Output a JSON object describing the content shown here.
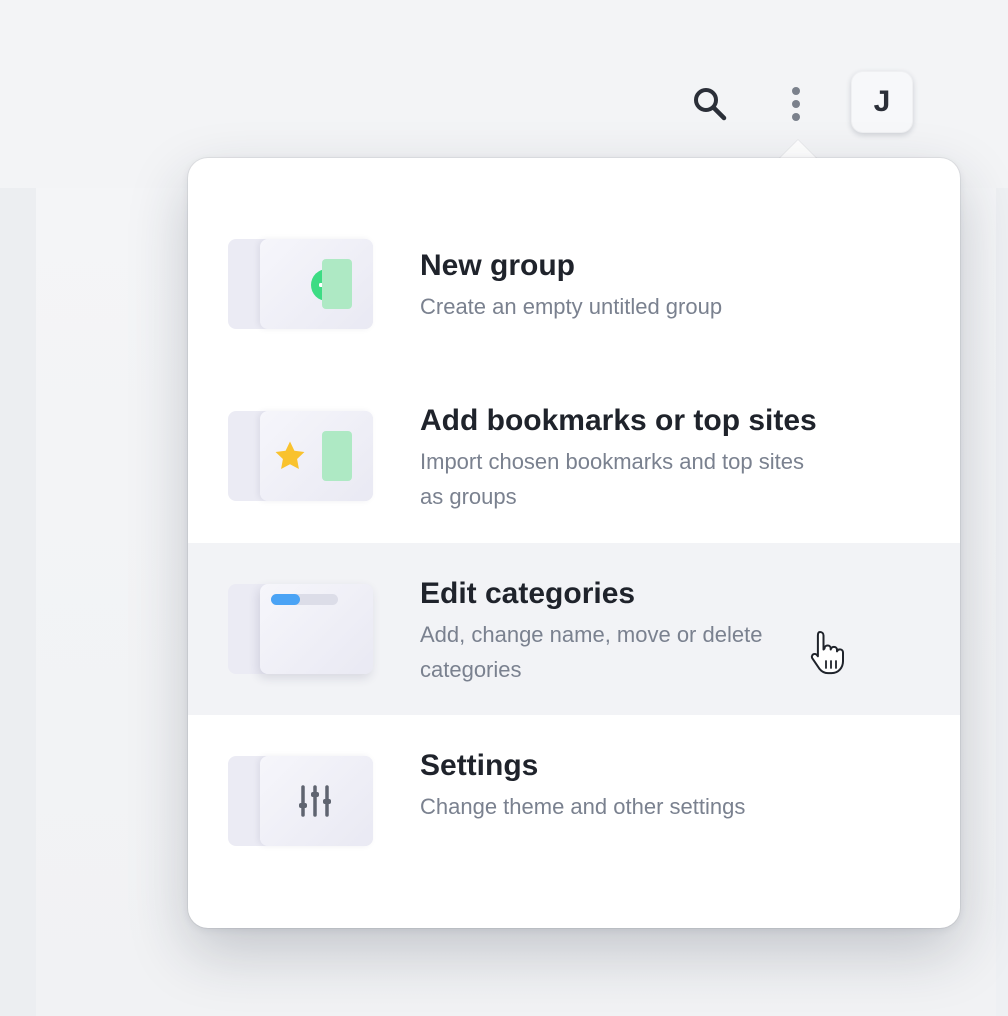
{
  "toolbar": {
    "search_icon": "search-icon",
    "more_icon": "more-vertical-icon",
    "avatar_initial": "J"
  },
  "menu": {
    "items": [
      {
        "title": "New group",
        "description": "Create an empty untitled group",
        "icon": "plus-circle-icon"
      },
      {
        "title": "Add bookmarks or top sites",
        "description": "Import chosen bookmarks and top sites as groups",
        "icon": "star-icon"
      },
      {
        "title": "Edit categories",
        "description": "Add, change name, move or delete categories",
        "icon": "progress-bar-icon",
        "highlighted": true,
        "progress": 0.43
      },
      {
        "title": "Settings",
        "description": "Change theme and other settings",
        "icon": "sliders-icon"
      }
    ]
  },
  "colors": {
    "accent_green": "#3ddc84",
    "tab_green": "#aee9c4",
    "star_yellow": "#f9c22e",
    "progress_blue": "#4aa3f5",
    "highlight": "#f2f3f6"
  }
}
